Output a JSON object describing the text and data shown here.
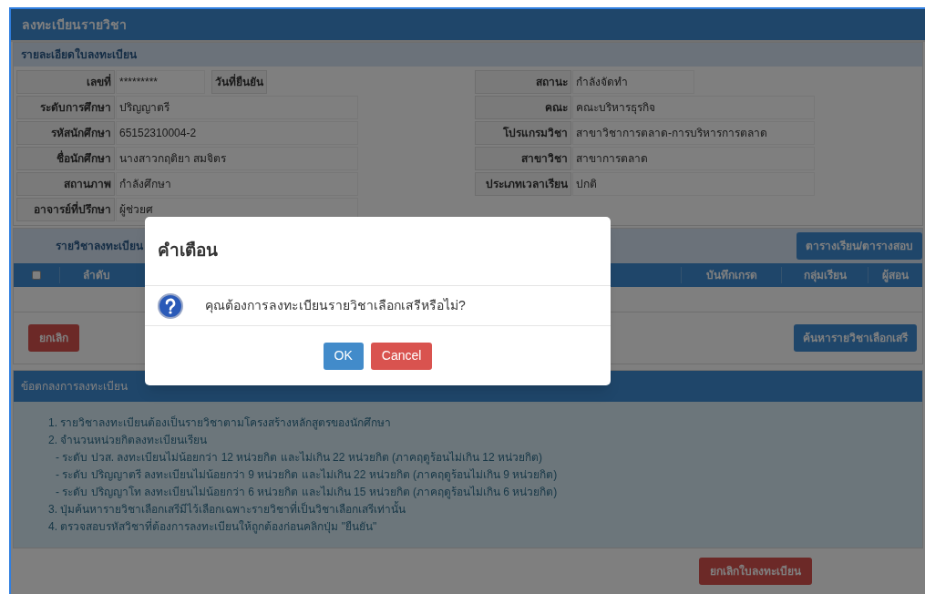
{
  "page_title": "ลงทะเบียนรายวิชา",
  "details": {
    "heading": "รายละเอียดใบลงทะเบียน",
    "left": [
      {
        "label": "เลขที่",
        "value": "*********",
        "extra_label": "วันที่ยืนยัน"
      },
      {
        "label": "ระดับการศึกษา",
        "value": "ปริญญาตรี"
      },
      {
        "label": "รหัสนักศึกษา",
        "value": "65152310004-2"
      },
      {
        "label": "ชื่อนักศึกษา",
        "value": "นางสาวกฤติยา สมจิตร"
      },
      {
        "label": "สถานภาพ",
        "value": "กำลังศึกษา"
      },
      {
        "label": "อาจารย์ที่ปรึกษา",
        "value": "ผู้ช่วยศ"
      }
    ],
    "right": [
      {
        "label": "สถานะ",
        "value": "กำลังจัดทำ"
      },
      {
        "label": "คณะ",
        "value": "คณะบริหารธุรกิจ"
      },
      {
        "label": "โปรแกรมวิชา",
        "value": "สาขาวิชาการตลาด-การบริหารการตลาด"
      },
      {
        "label": "สาขาวิชา",
        "value": "สาขาการตลาด"
      },
      {
        "label": "ประเภทเวลาเรียน",
        "value": "ปกติ"
      }
    ]
  },
  "courses": {
    "heading": "รายวิชาลงทะเบียน",
    "schedule_button": "ตารางเรียน/ตารางสอบ",
    "select_all_checked": false,
    "columns": [
      "ลำดับ",
      "บันทึกเกรด",
      "กลุ่มเรียน",
      "ผู้สอน"
    ],
    "cancel_button": "ยกเลิก",
    "search_button": "ค้นหารายวิชาเลือกเสรี"
  },
  "terms": {
    "heading": "ข้อตกลงการลงทะเบียน",
    "lines": [
      {
        "kind": "item",
        "text": "1. รายวิชาลงทะเบียนต้องเป็นรายวิชาตามโครงสร้างหลักสูตรของนักศึกษา"
      },
      {
        "kind": "item",
        "text": "2. จำนวนหน่วยกิตลงทะเบียนเรียน"
      },
      {
        "kind": "sub",
        "text": "- ระดับ ปวส. ลงทะเบียนไม่น้อยกว่า 12 หน่วยกิต และไม่เกิน 22 หน่วยกิต (ภาคฤดูร้อนไม่เกิน 12 หน่วยกิต)"
      },
      {
        "kind": "sub",
        "text": "- ระดับ ปริญญาตรี ลงทะเบียนไม่น้อยกว่า 9 หน่วยกิต และไม่เกิน 22 หน่วยกิต (ภาคฤดูร้อนไม่เกิน 9 หน่วยกิต)"
      },
      {
        "kind": "sub",
        "text": "- ระดับ ปริญญาโท ลงทะเบียนไม่น้อยกว่า 6 หน่วยกิต และไม่เกิน 15 หน่วยกิต (ภาคฤดูร้อนไม่เกิน 6 หน่วยกิต)"
      },
      {
        "kind": "item",
        "text": "3. ปุ่มค้นหารายวิชาเลือกเสรีมีไว้เลือกเฉพาะรายวิชาที่เป็นวิชาเลือกเสรีเท่านั้น"
      },
      {
        "kind": "item",
        "text": "4. ตรวจสอบรหัสวิชาที่ต้องการลงทะเบียนให้ถูกต้องก่อนคลิกปุ่ม \"ยืนยัน\""
      }
    ]
  },
  "cancel_registration_button": "ยกเลิกใบลงทะเบียน",
  "dialog": {
    "title": "คำเตือน",
    "message": "คุณต้องการลงทะเบียนรายวิชาเลือกเสรีหรือไม่?",
    "ok_button": "OK",
    "cancel_button": "Cancel"
  }
}
